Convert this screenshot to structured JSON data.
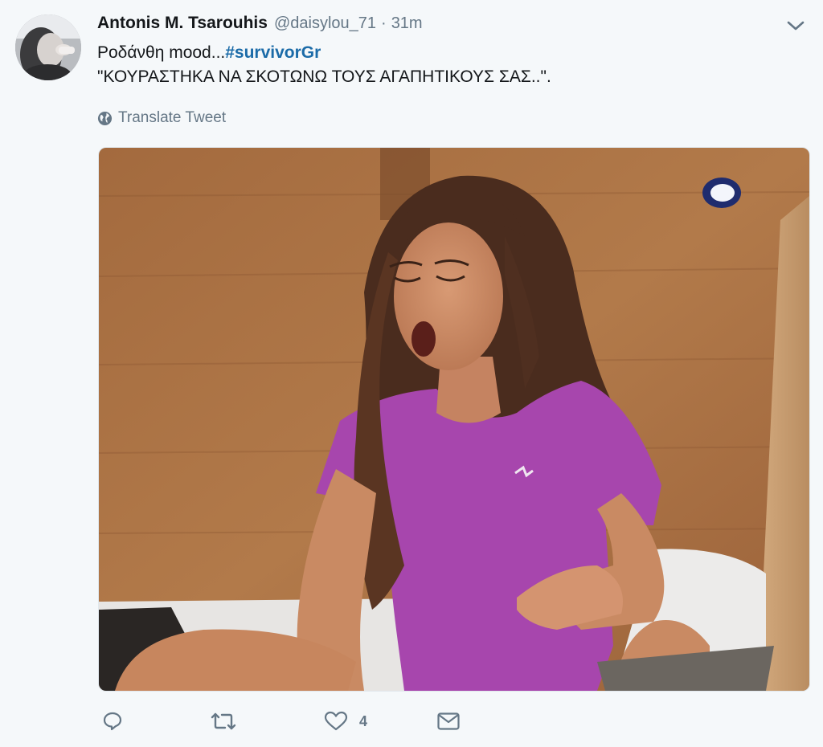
{
  "tweet": {
    "display_name": "Antonis M. Tsarouhis",
    "handle": "@daisylou_71",
    "separator": "·",
    "time": "31m",
    "line1_text": "Ροδάνθη mood...",
    "hashtag": "#survivorGr",
    "line2_text": "\"ΚΟΥΡΑΣΤΗΚΑ ΝΑ ΣΚΟΤΩΝΩ ΤΟΥΣ ΑΓΑΠΗΤΙΚΟΥΣ ΣΑΣ..\".",
    "translate_label": "Translate Tweet"
  },
  "icons": {
    "more": "chevron-down-icon",
    "translate": "globe-icon",
    "reply": "reply-icon",
    "retweet": "retweet-icon",
    "like": "heart-icon",
    "dm": "envelope-icon"
  },
  "actions": {
    "reply_count": "",
    "retweet_count": "",
    "like_count": "4",
    "dm_count": ""
  },
  "colors": {
    "background": "#f5f8fa",
    "hashtag": "#1b6ba8",
    "muted": "#657786"
  }
}
